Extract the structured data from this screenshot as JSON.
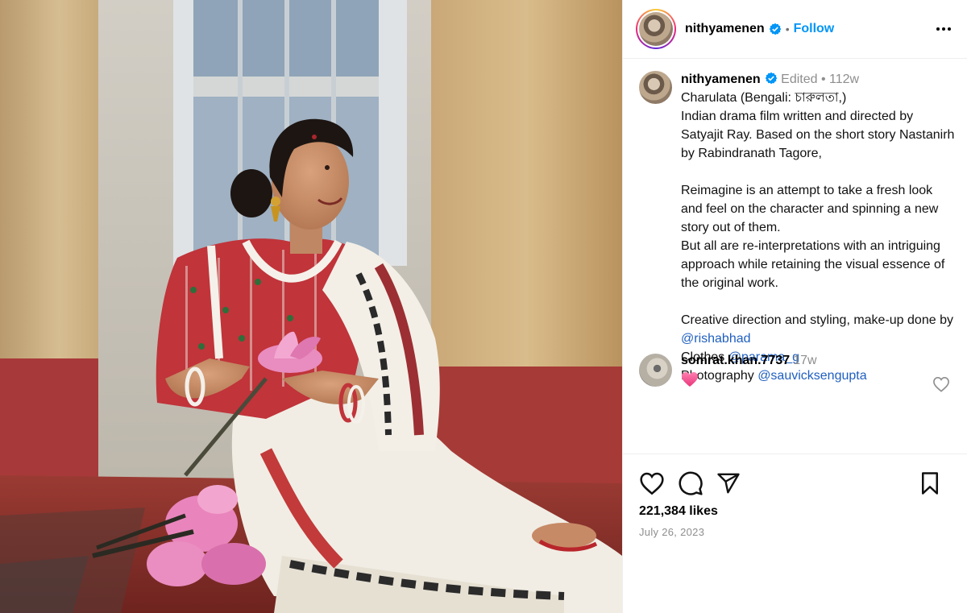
{
  "post": {
    "author": "nithyamenen",
    "follow_label": "Follow",
    "dot": "•",
    "edited_label": "Edited",
    "age": "112w",
    "caption": "Charulata (Bengali: চারুলতা,)\nIndian drama film written and directed by Satyajit Ray. Based on the short story Nastanirh by Rabindranath Tagore,\n\nReimagine is an attempt to take a fresh look and feel on the character and spinning a new story out of them.\nBut all are re-interpretations with an intriguing approach while retaining the visual essence of the original work.\n\nCreative direction and styling, make-up done by ",
    "credits": {
      "styling_mention": "@rishabhad",
      "clothes_label": "Clothes ",
      "clothes_mention": "@parama_g",
      "photo_label": "Photography ",
      "photo_mention": "@sauvicksengupta"
    }
  },
  "comments": [
    {
      "username": "somrat.khan.7737",
      "age": "17w",
      "text": "heart-emoji"
    }
  ],
  "stats": {
    "likes": "221,384 likes",
    "date": "July 26, 2023"
  },
  "icons": {
    "verified": "verified-badge-icon",
    "more": "more-options-icon",
    "like": "heart-icon",
    "comment": "comment-bubble-icon",
    "share": "paper-plane-icon",
    "save": "bookmark-icon"
  },
  "colors": {
    "accent": "#0095f6",
    "mention": "#1f5fbf",
    "muted": "#8e8e8e"
  }
}
